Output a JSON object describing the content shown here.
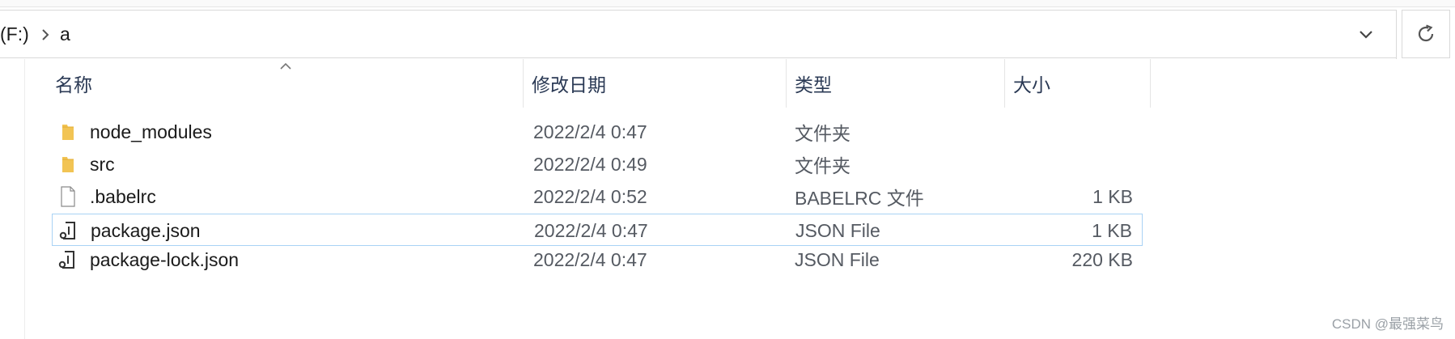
{
  "address_bar": {
    "drive": "(F:)",
    "folder": "a"
  },
  "columns": {
    "name": "名称",
    "date": "修改日期",
    "type": "类型",
    "size": "大小"
  },
  "rows": [
    {
      "icon": "folder-icon",
      "name": "node_modules",
      "date": "2022/2/4 0:47",
      "type": "文件夹",
      "size": ""
    },
    {
      "icon": "folder-icon",
      "name": "src",
      "date": "2022/2/4 0:49",
      "type": "文件夹",
      "size": ""
    },
    {
      "icon": "file-icon",
      "name": ".babelrc",
      "date": "2022/2/4 0:52",
      "type": "BABELRC 文件",
      "size": "1 KB"
    },
    {
      "icon": "json-file-icon",
      "name": "package.json",
      "date": "2022/2/4 0:47",
      "type": "JSON File",
      "size": "1 KB",
      "selected": true
    },
    {
      "icon": "json-file-icon",
      "name": "package-lock.json",
      "date": "2022/2/4 0:47",
      "type": "JSON File",
      "size": "220 KB"
    }
  ],
  "watermark": "CSDN @最强菜鸟",
  "colors": {
    "folder": "#f2c454",
    "selection_border": "#a9d2f5",
    "header_text": "#2b3a55"
  }
}
